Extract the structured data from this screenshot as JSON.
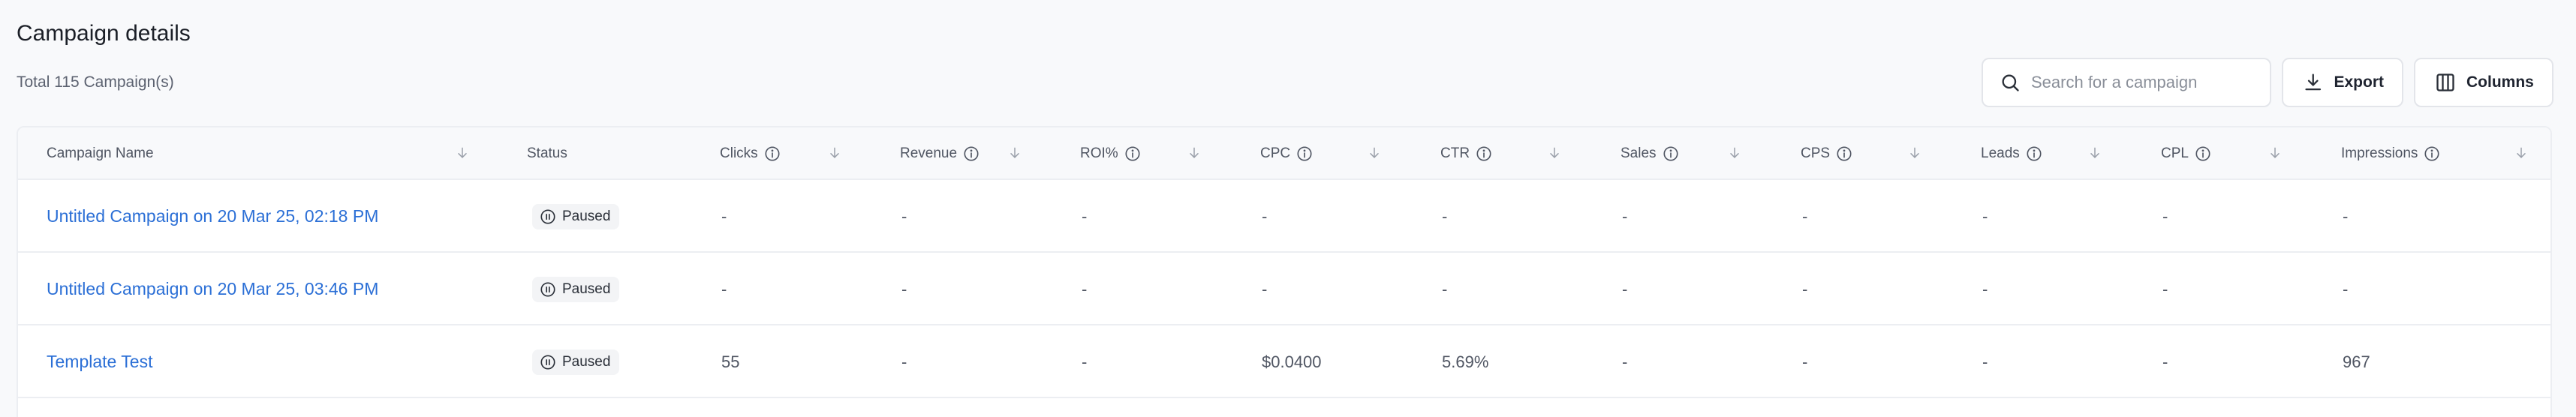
{
  "header": {
    "title": "Campaign details",
    "total": "Total 115 Campaign(s)"
  },
  "toolbar": {
    "search_placeholder": "Search for a campaign",
    "export_label": "Export",
    "columns_label": "Columns"
  },
  "table": {
    "columns": {
      "name": "Campaign Name",
      "status": "Status",
      "clicks": "Clicks",
      "revenue": "Revenue",
      "roi": "ROI%",
      "cpc": "CPC",
      "ctr": "CTR",
      "sales": "Sales",
      "cps": "CPS",
      "leads": "Leads",
      "cpl": "CPL",
      "impressions": "Impressions"
    },
    "rows": [
      {
        "name": "Untitled Campaign on 20 Mar 25, 02:18 PM",
        "status": "Paused",
        "clicks": "-",
        "revenue": "-",
        "roi": "-",
        "cpc": "-",
        "ctr": "-",
        "sales": "-",
        "cps": "-",
        "leads": "-",
        "cpl": "-",
        "impressions": "-"
      },
      {
        "name": "Untitled Campaign on 20 Mar 25, 03:46 PM",
        "status": "Paused",
        "clicks": "-",
        "revenue": "-",
        "roi": "-",
        "cpc": "-",
        "ctr": "-",
        "sales": "-",
        "cps": "-",
        "leads": "-",
        "cpl": "-",
        "impressions": "-"
      },
      {
        "name": "Template Test",
        "status": "Paused",
        "clicks": "55",
        "revenue": "-",
        "roi": "-",
        "cpc": "$0.0400",
        "ctr": "5.69%",
        "sales": "-",
        "cps": "-",
        "leads": "-",
        "cpl": "-",
        "impressions": "967"
      }
    ]
  },
  "colors": {
    "link": "#2b6fd6",
    "background": "#f8f9fb",
    "border": "#eceef2"
  }
}
